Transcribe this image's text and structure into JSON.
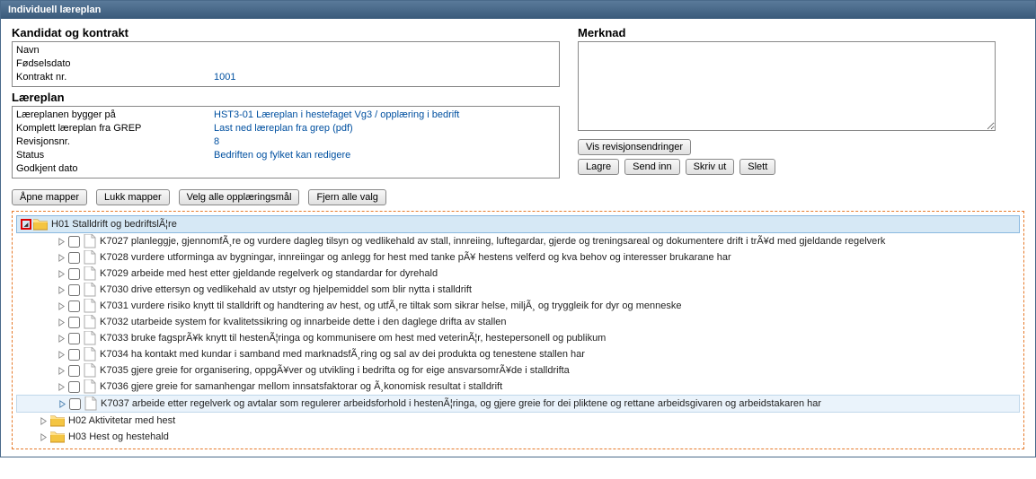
{
  "window": {
    "title": "Individuell læreplan"
  },
  "kandidat": {
    "heading": "Kandidat og kontrakt",
    "navn_label": "Navn",
    "navn_value": "",
    "fodsel_label": "Fødselsdato",
    "fodsel_value": "",
    "kontrakt_label": "Kontrakt nr.",
    "kontrakt_value": "1001"
  },
  "laereplan": {
    "heading": "Læreplan",
    "bygger_label": "Læreplanen bygger på",
    "bygger_value": "HST3-01 Læreplan i hestefaget Vg3 / opplæring i bedrift",
    "grep_label": "Komplett læreplan fra GREP",
    "grep_value": "Last ned læreplan fra grep (pdf)",
    "revisjon_label": "Revisjonsnr.",
    "revisjon_value": "8",
    "status_label": "Status",
    "status_value": "Bedriften og fylket kan redigere",
    "godkjent_label": "Godkjent dato",
    "godkjent_value": ""
  },
  "merknad": {
    "heading": "Merknad",
    "value": ""
  },
  "buttons": {
    "vis_revisjon": "Vis revisjonsendringer",
    "lagre": "Lagre",
    "send_inn": "Send inn",
    "skriv_ut": "Skriv ut",
    "slett": "Slett",
    "apne_mapper": "Åpne mapper",
    "lukk_mapper": "Lukk mapper",
    "velg_alle": "Velg alle opplæringsmål",
    "fjern_alle": "Fjern alle valg"
  },
  "tree": {
    "h01": "H01 Stalldrift og bedriftslÃ¦re",
    "k7027": "K7027 planleggje, gjennomfÃ¸re og vurdere dagleg tilsyn og vedlikehald av stall, innreiing, luftegardar, gjerde og treningsareal og dokumentere drift i trÃ¥d med gjeldande regelverk",
    "k7028": "K7028 vurdere utforminga av bygningar, innreiingar og anlegg for hest med tanke pÃ¥ hestens velferd og kva behov og interesser brukarane har",
    "k7029": "K7029 arbeide med hest etter gjeldande regelverk og standardar for dyrehald",
    "k7030": "K7030 drive ettersyn og vedlikehald av utstyr og hjelpemiddel som blir nytta i stalldrift",
    "k7031": "K7031 vurdere risiko knytt til stalldrift og handtering av hest, og utfÃ¸re tiltak som sikrar helse, miljÃ¸ og tryggleik for dyr og menneske",
    "k7032": "K7032 utarbeide system for kvalitetssikring og innarbeide dette i den daglege drifta av stallen",
    "k7033": "K7033 bruke fagsprÃ¥k knytt til hestenÃ¦ringa og kommunisere om hest med veterinÃ¦r, hestepersonell og publikum",
    "k7034": "K7034 ha kontakt med kundar i samband med marknadsfÃ¸ring og sal av dei produkta og tenestene stallen har",
    "k7035": "K7035 gjere greie for organisering, oppgÃ¥ver og utvikling i bedrifta og for eige ansvarsomrÃ¥de i stalldrifta",
    "k7036": "K7036 gjere greie for samanhengar mellom innsatsfaktorar og Ã¸konomisk resultat i stalldrift",
    "k7037": "K7037 arbeide etter regelverk og avtalar som regulerer arbeidsforhold i hestenÃ¦ringa, og gjere greie for dei pliktene og rettane arbeidsgivaren og arbeidstakaren har",
    "h02": "H02 Aktivitetar med hest",
    "h03": "H03 Hest og hestehald"
  }
}
